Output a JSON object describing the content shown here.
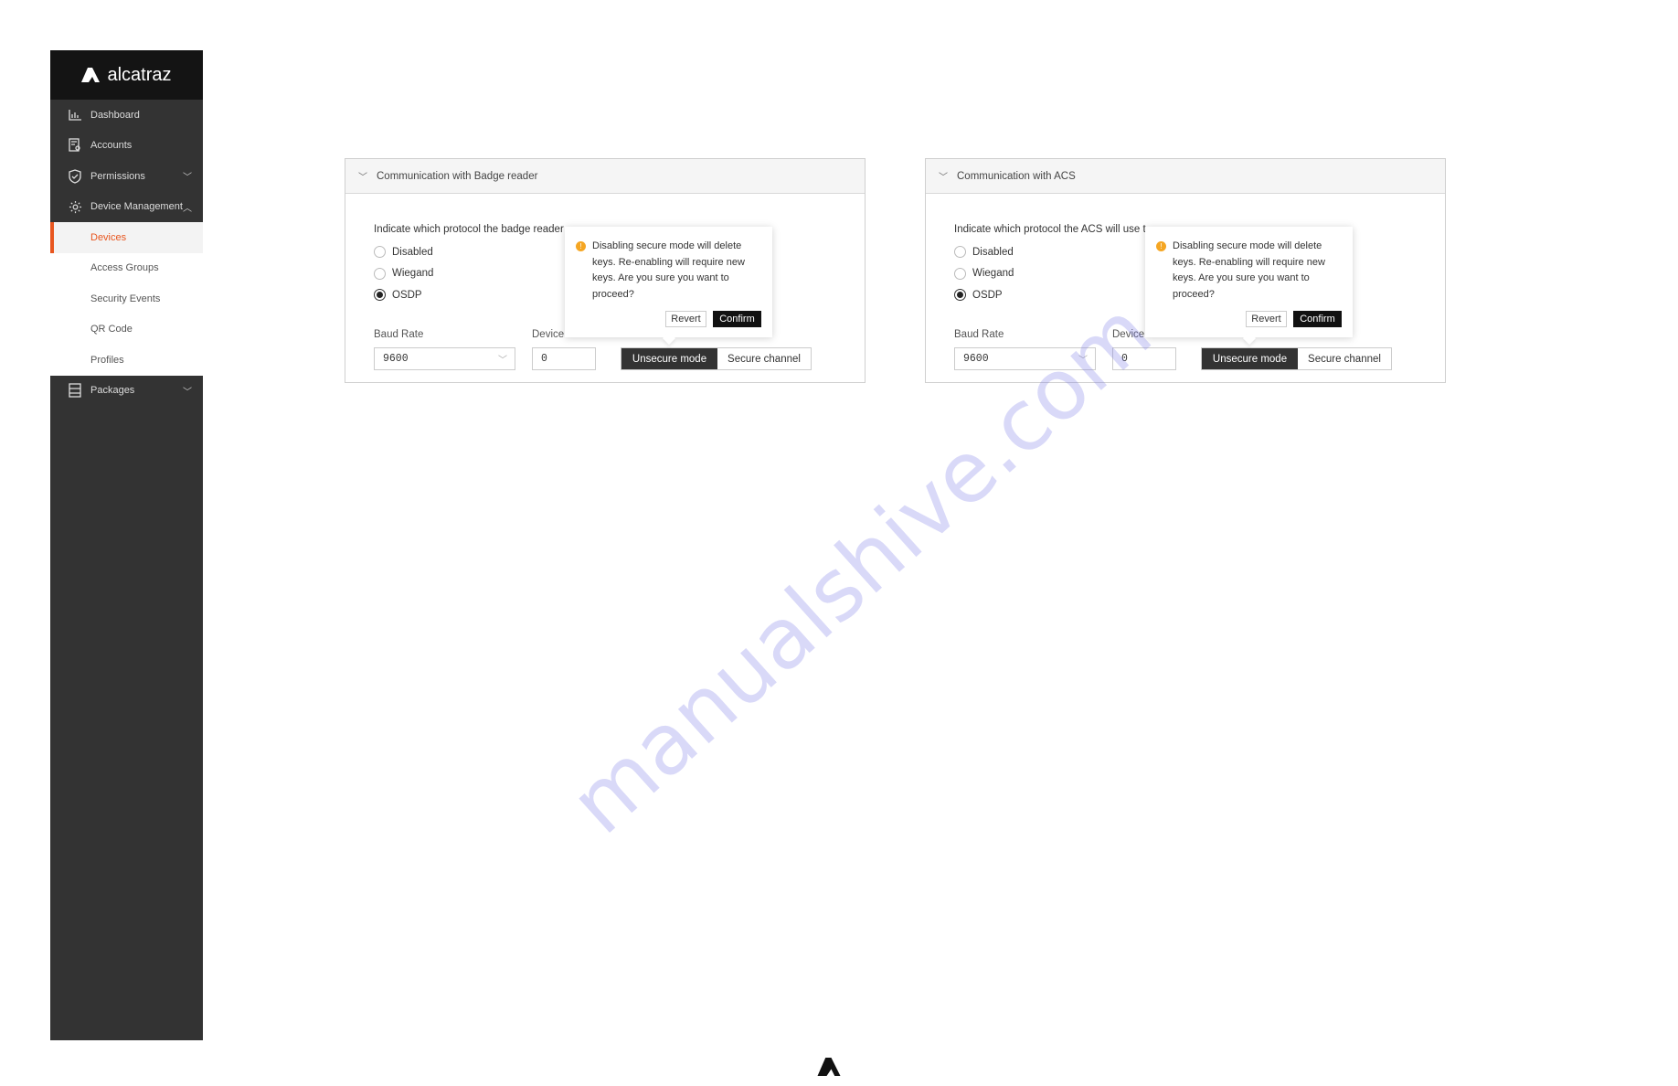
{
  "brand": {
    "name": "alcatraz",
    "accent": "#e8561f"
  },
  "sidebar": {
    "items": [
      {
        "label": "Dashboard",
        "icon": "bar-chart-icon"
      },
      {
        "label": "Accounts",
        "icon": "accounts-icon"
      },
      {
        "label": "Permissions",
        "icon": "shield-check-icon",
        "chevron": "down"
      },
      {
        "label": "Device Management",
        "icon": "gear-icon",
        "chevron": "up"
      },
      {
        "label": "Devices",
        "active": true
      },
      {
        "label": "Access Groups"
      },
      {
        "label": "Security Events"
      },
      {
        "label": "QR Code"
      },
      {
        "label": "Profiles"
      },
      {
        "label": "Packages",
        "icon": "server-icon",
        "chevron": "down"
      }
    ]
  },
  "panels": [
    {
      "title": "Communication with Badge reader",
      "question": "Indicate which protocol the badge reader",
      "radios": [
        "Disabled",
        "Wiegand",
        "OSDP"
      ],
      "selected": "OSDP",
      "baud_label": "Baud Rate",
      "baud_value": "9600",
      "device_label": "Device",
      "device_value": "0",
      "mode_on": "Unsecure mode",
      "mode_off": "Secure channel",
      "popover": {
        "message": "Disabling secure mode will delete keys. Re-enabling will require new keys. Are you sure you want to proceed?",
        "revert": "Revert",
        "confirm": "Confirm"
      }
    },
    {
      "title": "Communication with ACS",
      "question": "Indicate which protocol the ACS will use t",
      "radios": [
        "Disabled",
        "Wiegand",
        "OSDP"
      ],
      "selected": "OSDP",
      "baud_label": "Baud Rate",
      "baud_value": "9600",
      "device_label": "Device",
      "device_value": "0",
      "mode_on": "Unsecure mode",
      "mode_off": "Secure channel",
      "popover": {
        "message": "Disabling secure mode will delete keys. Re-enabling will require new keys. Are you sure you want to proceed?",
        "revert": "Revert",
        "confirm": "Confirm"
      }
    }
  ],
  "watermark": "manualshive.com"
}
